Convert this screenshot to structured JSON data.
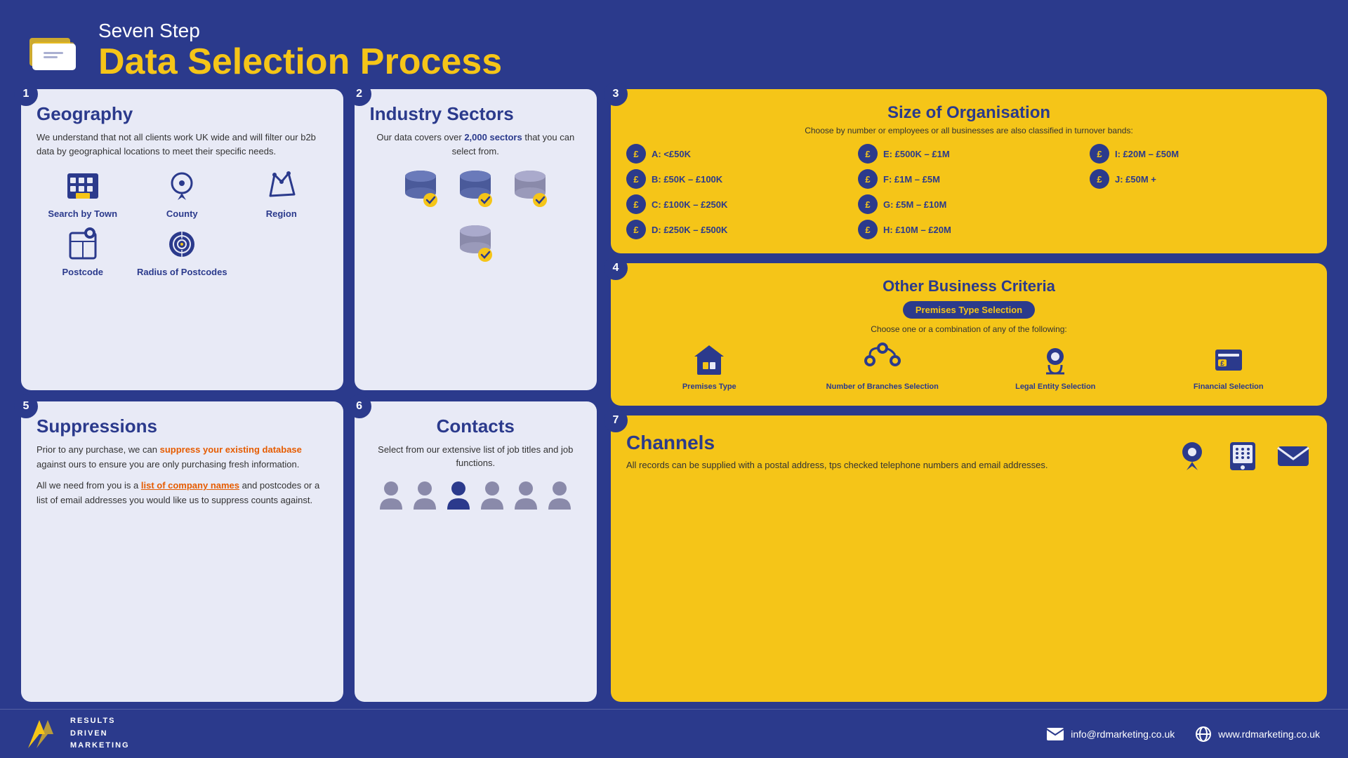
{
  "header": {
    "subtitle": "Seven Step",
    "title": "Data Selection Process"
  },
  "step1": {
    "number": "1",
    "title": "Geography",
    "desc": "We understand that not all clients work UK wide and will filter our b2b data by geographical locations to meet their specific needs.",
    "items": [
      {
        "label": "Search by Town"
      },
      {
        "label": "County"
      },
      {
        "label": "Region"
      },
      {
        "label": "Postcode"
      },
      {
        "label": "Radius of Postcodes"
      }
    ]
  },
  "step2": {
    "number": "2",
    "title": "Industry Sectors",
    "desc_part1": "Our data covers over ",
    "desc_highlight": "2,000 sectors",
    "desc_part2": " that you can select from."
  },
  "step3": {
    "number": "3",
    "title": "Size of Organisation",
    "subtitle": "Choose by number or employees or all businesses are also classified in turnover bands:",
    "bands": [
      {
        "label": "A: <£50K"
      },
      {
        "label": "E: £500K – £1M"
      },
      {
        "label": "I: £20M – £50M"
      },
      {
        "label": "B: £50K – £100K"
      },
      {
        "label": "F: £1M – £5M"
      },
      {
        "label": "J: £50M +"
      },
      {
        "label": "C: £100K – £250K"
      },
      {
        "label": "G: £5M – £10M"
      },
      {
        "label": ""
      },
      {
        "label": "D: £250K – £500K"
      },
      {
        "label": "H: £10M – £20M"
      },
      {
        "label": ""
      }
    ]
  },
  "step4": {
    "number": "4",
    "title": "Other Business Criteria",
    "badge": "Premises Type Selection",
    "subtitle": "Choose one or a combination of any of the following:",
    "criteria": [
      {
        "label": "Premises Type"
      },
      {
        "label": "Number of Branches Selection"
      },
      {
        "label": "Legal Entity Selection"
      },
      {
        "label": "Financial Selection"
      }
    ]
  },
  "step5": {
    "number": "5",
    "title": "Suppressions",
    "para1_prefix": "Prior to any purchase, we can ",
    "para1_highlight": "suppress your existing database",
    "para1_suffix": " against ours to ensure you are only purchasing fresh information.",
    "para2_prefix": "All we need from you is a ",
    "para2_highlight": "list of company names",
    "para2_suffix": " and postcodes or a list of email addresses you would like us to suppress counts against."
  },
  "step6": {
    "number": "6",
    "title": "Contacts",
    "desc": "Select from our extensive list of job titles and job functions."
  },
  "step7": {
    "number": "7",
    "title": "Channels",
    "desc": "All records can be supplied with a postal address, tps checked telephone numbers and email addresses."
  },
  "footer": {
    "logo_lines": [
      "RESULTS",
      "DRIVEN",
      "MARKETING"
    ],
    "email": "info@rdmarketing.co.uk",
    "website": "www.rdmarketing.co.uk"
  }
}
